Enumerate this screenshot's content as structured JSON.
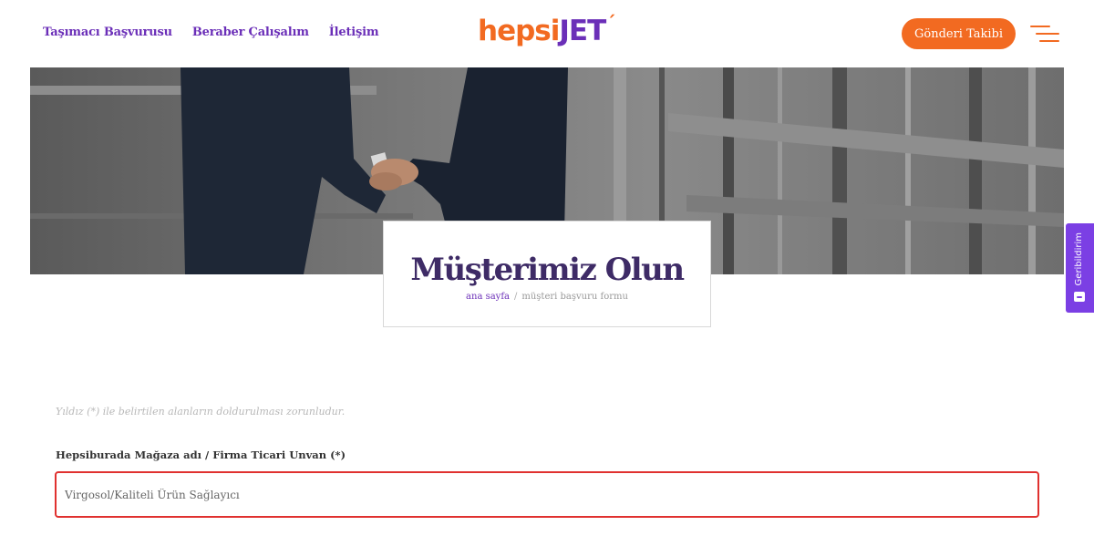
{
  "header": {
    "nav": {
      "carrier": "Taşımacı Başvurusu",
      "partner": "Beraber Çalışalım",
      "contact": "İletişim"
    },
    "logo": {
      "part1": "hepsi",
      "part2": "JET",
      "tick": "´"
    },
    "track_button": "Gönderi Takibi",
    "menu_icon": "hamburger-menu-icon"
  },
  "hero": {
    "title": "Müşterimiz Olun",
    "breadcrumb": {
      "home": "ana sayfa",
      "separator": "/",
      "current": "müşteri başvuru formu"
    }
  },
  "feedback_tab": {
    "label": "Geribildirim",
    "icon": "feedback-icon"
  },
  "form": {
    "note": "Yıldız (*) ile belirtilen alanların doldurulması zorunludur.",
    "store_name": {
      "label": "Hepsiburada Mağaza adı / Firma Ticari Unvan (*)",
      "value": "Virgosol/Kaliteli Ürün Sağlayıcı"
    }
  },
  "colors": {
    "brand_orange": "#f26a21",
    "brand_purple": "#6b2fb8",
    "title_purple": "#3e2b66",
    "error_red": "#e0312f",
    "feedback_purple": "#7b3fe4"
  }
}
